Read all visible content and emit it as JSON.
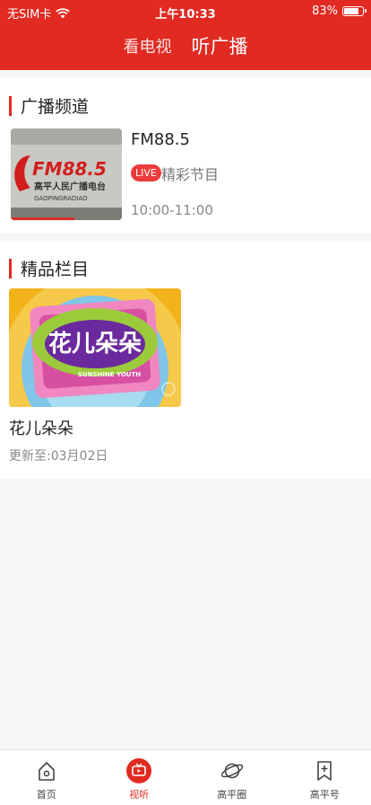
{
  "status_bar": {
    "carrier": "无SIM卡",
    "time": "上午10:33",
    "battery": "83%",
    "battery_level": 0.83
  },
  "header": {
    "tabs": [
      {
        "label": "看电视"
      },
      {
        "label": "听广播",
        "active": true
      }
    ]
  },
  "radio_section": {
    "title": "广播频道",
    "channel": {
      "name": "FM88.5",
      "live_badge": "LIVE",
      "program": "精彩节目",
      "time_range": "10:00-11:00",
      "thumb_text": "FM88.5",
      "thumb_subtitle": "高平人民广播电台",
      "thumb_url": "GAOPINGRADIAO",
      "progress": 0.57
    }
  },
  "featured_section": {
    "title": "精品栏目",
    "items": [
      {
        "title": "花儿朵朵",
        "updated": "更新至:03月02日",
        "logo_text": "花儿朵朵",
        "logo_sub": "SUNSHINE YOUTH"
      }
    ]
  },
  "bottom_nav": {
    "items": [
      {
        "label": "首页",
        "icon": "home-icon"
      },
      {
        "label": "视听",
        "icon": "tv-icon",
        "active": true
      },
      {
        "label": "高平圈",
        "icon": "planet-icon"
      },
      {
        "label": "高平号",
        "icon": "bookmark-plus-icon"
      }
    ]
  },
  "colors": {
    "accent": "#e02a22",
    "background": "#f6f6f6",
    "live_badge": "#ec3b3b"
  }
}
